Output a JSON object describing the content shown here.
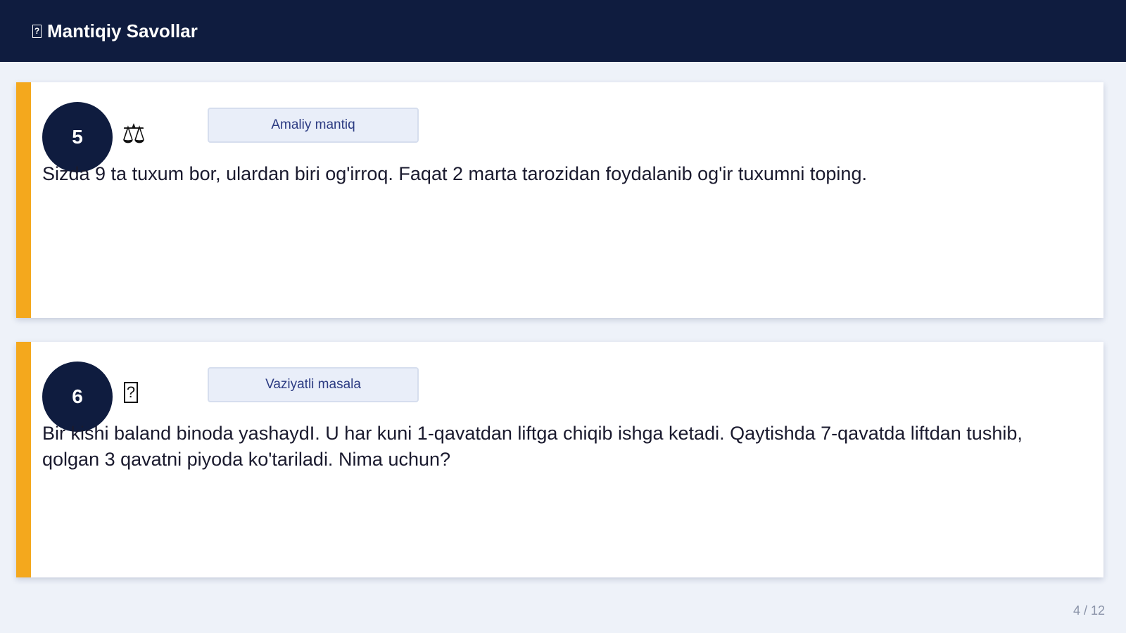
{
  "header": {
    "title": "Mantiqiy Savollar",
    "icon": "question-box-icon"
  },
  "cards": [
    {
      "number": "5",
      "icon": "scales-icon",
      "icon_glyph": "⚖",
      "category": "Amaliy mantiq",
      "question": "Sizda 9 ta tuxum bor, ulardan biri og'irroq. Faqat 2 marta tarozidan foydalanib og'ir tuxumni toping."
    },
    {
      "number": "6",
      "icon": "question-box-icon",
      "icon_glyph": "?",
      "category": "Vaziyatli masala",
      "question": "Bir kishi baland binoda yashaydI. U har kuni 1-qavatdan liftga chiqib ishga ketadi. Qaytishda 7-qavatda liftdan tushib, qolgan 3 qavatni piyoda ko'tariladi. Nima uchun?"
    }
  ],
  "pagination": {
    "label": "4 / 12"
  },
  "colors": {
    "header_bg": "#0f1c3f",
    "accent": "#f4a81d",
    "tag_text": "#2c3b82"
  }
}
